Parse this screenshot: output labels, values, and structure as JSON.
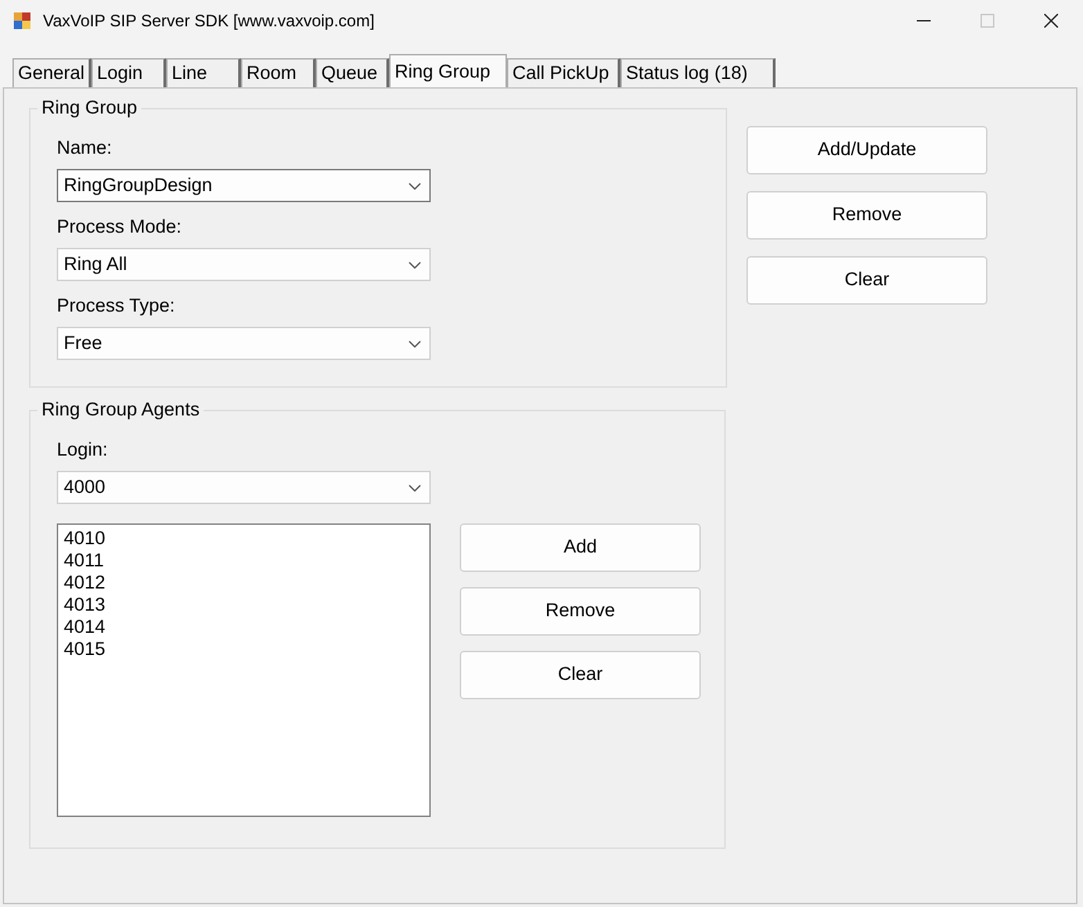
{
  "window": {
    "title": "VaxVoIP SIP Server SDK [www.vaxvoip.com]",
    "controls": [
      {
        "kind": "minimize",
        "disabled": false
      },
      {
        "kind": "maximize",
        "disabled": true
      },
      {
        "kind": "close",
        "disabled": false
      }
    ]
  },
  "tabs": [
    {
      "label": "General",
      "selected": false
    },
    {
      "label": "Login",
      "selected": false
    },
    {
      "label": "Line",
      "selected": false
    },
    {
      "label": "Room",
      "selected": false
    },
    {
      "label": "Queue",
      "selected": false
    },
    {
      "label": "Ring Group",
      "selected": true
    },
    {
      "label": "Call PickUp",
      "selected": false
    },
    {
      "label": "Status log (18)",
      "selected": false
    }
  ],
  "ring_group": {
    "title": "Ring Group",
    "fields": [
      {
        "label": "Name:",
        "value": "RingGroupDesign",
        "focused": true
      },
      {
        "label": "Process Mode:",
        "value": "Ring All",
        "focused": false
      },
      {
        "label": "Process Type:",
        "value": "Free",
        "focused": false
      }
    ]
  },
  "side_buttons": [
    "Add/Update",
    "Remove",
    "Clear"
  ],
  "agents": {
    "title": "Ring Group Agents",
    "login": {
      "label": "Login:",
      "value": "4000",
      "focused": false
    },
    "list": [
      "4010",
      "4011",
      "4012",
      "4013",
      "4014",
      "4015"
    ],
    "buttons": [
      "Add",
      "Remove",
      "Clear"
    ]
  }
}
